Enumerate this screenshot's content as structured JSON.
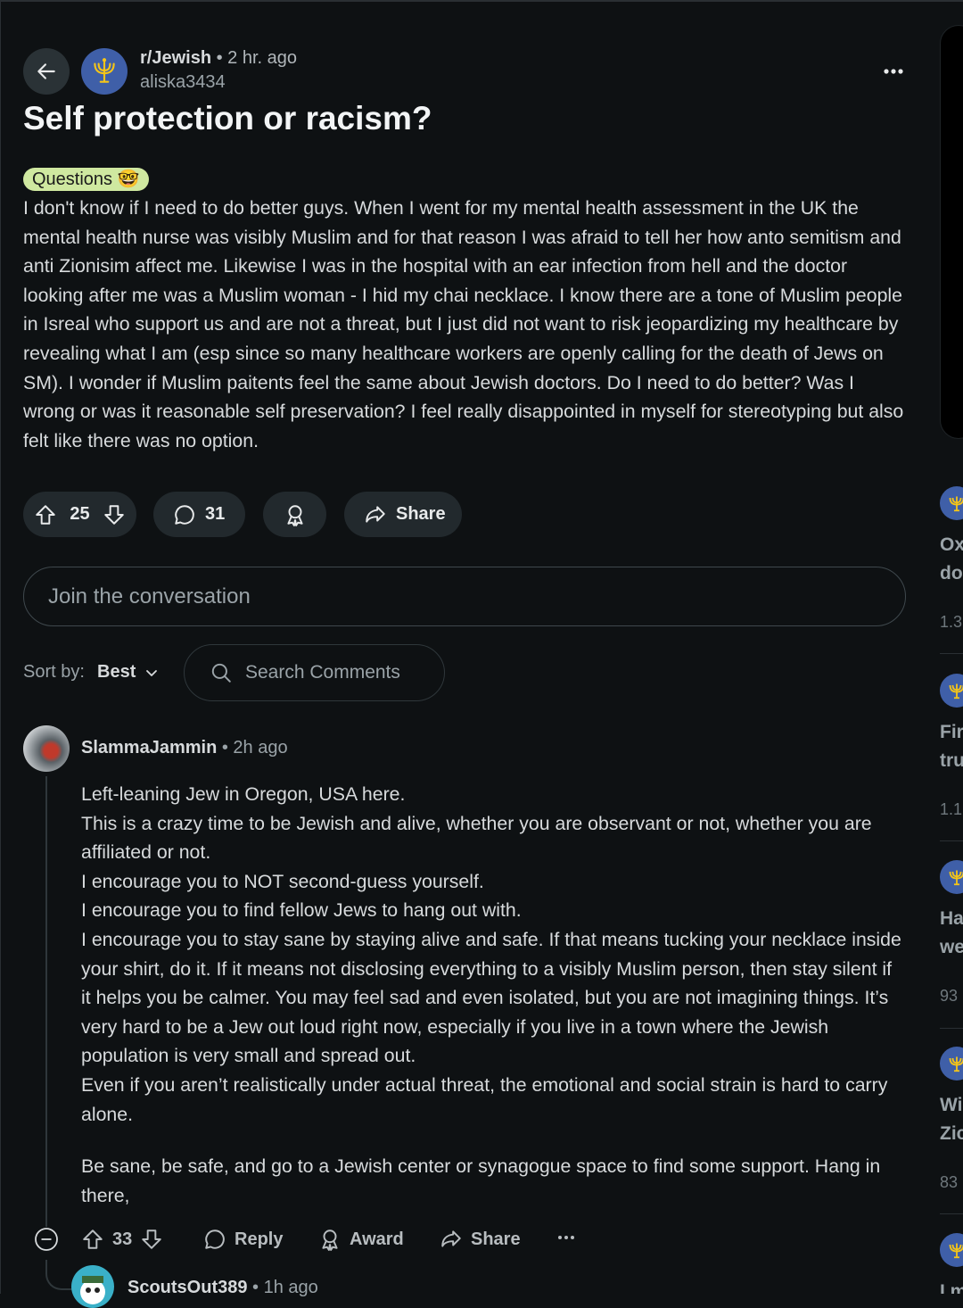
{
  "post": {
    "subreddit": "r/Jewish",
    "time": "2 hr. ago",
    "author": "aliska3434",
    "title": "Self protection or racism?",
    "flair": "Questions 🤓",
    "body": "I don't know if I need to do better guys. When I went for my mental health assessment in the UK the mental health nurse was visibly Muslim and for that reason I was afraid to tell her how anto semitism and anti Zionisim affect me. Likewise I was in the hospital with an ear infection from hell and the doctor looking after me was a Muslim woman - I hid my chai necklace. I know there are a tone of Muslim people in Isreal who support us and are not a threat, but I just did not want to risk jeopardizing my healthcare by revealing what I am (esp since so many healthcare workers are openly calling for the death of Jews on SM). I wonder if Muslim paitents feel the same about Jewish doctors. Do I need to do better? Was I wrong or was it reasonable self preservation? I feel really disappointed in myself for stereotyping but also felt like there was no option.",
    "votes": "25",
    "comments": "31",
    "share_label": "Share"
  },
  "join_placeholder": "Join the conversation",
  "sort": {
    "label": "Sort by:",
    "value": "Best"
  },
  "search_placeholder": "Search Comments",
  "comment": {
    "author": "SlammaJammin",
    "time": "2h ago",
    "lines": [
      "Left-leaning Jew in Oregon, USA here.",
      "This is a crazy time to be Jewish and alive, whether you are observant or not, whether you are affiliated or not.",
      "I encourage you to NOT second-guess yourself.",
      "I encourage you to find fellow Jews to hang out with.",
      "I encourage you to stay sane by staying alive and safe. If that means tucking your necklace inside your shirt, do it. If it means not disclosing everything to a visibly Muslim person, then stay silent if it helps you be calmer. You may feel sad and even isolated, but you are not imagining things. It’s very hard to be a Jew out loud right now, especially if you live in a town where the Jewish population is very small and spread out.",
      "Even if you aren’t realistically under actual threat, the emotional and social strain is hard to carry alone."
    ],
    "closing": "Be sane, be safe, and go to a Jewish center or synagogue space to find some support. Hang in there,",
    "votes": "33",
    "reply_label": "Reply",
    "award_label": "Award",
    "share_label": "Share"
  },
  "reply": {
    "author": "ScoutsOut389",
    "time": "1h ago"
  },
  "sidebar": [
    {
      "t1": "Ox",
      "t2": "do",
      "meta": "1.3"
    },
    {
      "t1": "Fir",
      "t2": "tru",
      "meta": "1.1"
    },
    {
      "t1": "Ha",
      "t2": "we",
      "meta": "93"
    },
    {
      "t1": "Wi",
      "t2": "Zic",
      "meta": "83"
    },
    {
      "t1": "I m",
      "t2": "",
      "meta": ""
    }
  ]
}
